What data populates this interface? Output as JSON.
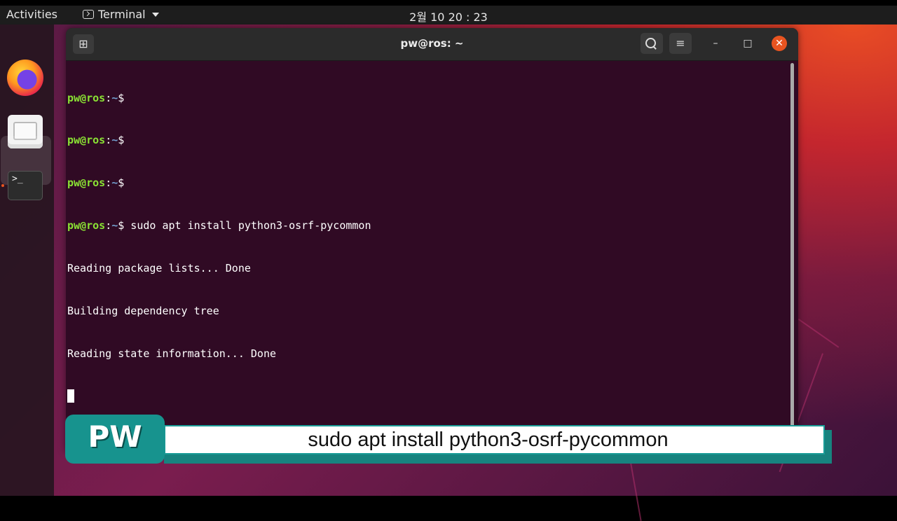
{
  "topbar": {
    "activities": "Activities",
    "app_name": "Terminal",
    "clock": "2월 10  20 : 23"
  },
  "dock": {
    "items": [
      {
        "name": "Firefox",
        "icon": "firefox-icon"
      },
      {
        "name": "Files",
        "icon": "files-icon"
      },
      {
        "name": "Terminal",
        "icon": "terminal-icon",
        "glyph": ">_",
        "running": true
      }
    ]
  },
  "window": {
    "title": "pw@ros: ~",
    "buttons": {
      "new_tab": "⊞",
      "search": "search-icon",
      "menu": "≡",
      "minimize": "–",
      "maximize": "□",
      "close": "✕"
    }
  },
  "terminal": {
    "user_host": "pw@ros",
    "colon": ":",
    "path": "~",
    "prompt_symbol": "$",
    "command": " sudo apt install python3-osrf-pycommon",
    "output": [
      "Reading package lists... Done",
      "Building dependency tree",
      "Reading state information... Done"
    ]
  },
  "caption": {
    "logo": "PW",
    "text": "sudo apt install python3-osrf-pycommon"
  },
  "colors": {
    "terminal_bg": "#300a24",
    "prompt_user": "#8ae234",
    "prompt_path": "#729fcf",
    "accent": "#e95420",
    "caption_teal": "#17938e"
  }
}
